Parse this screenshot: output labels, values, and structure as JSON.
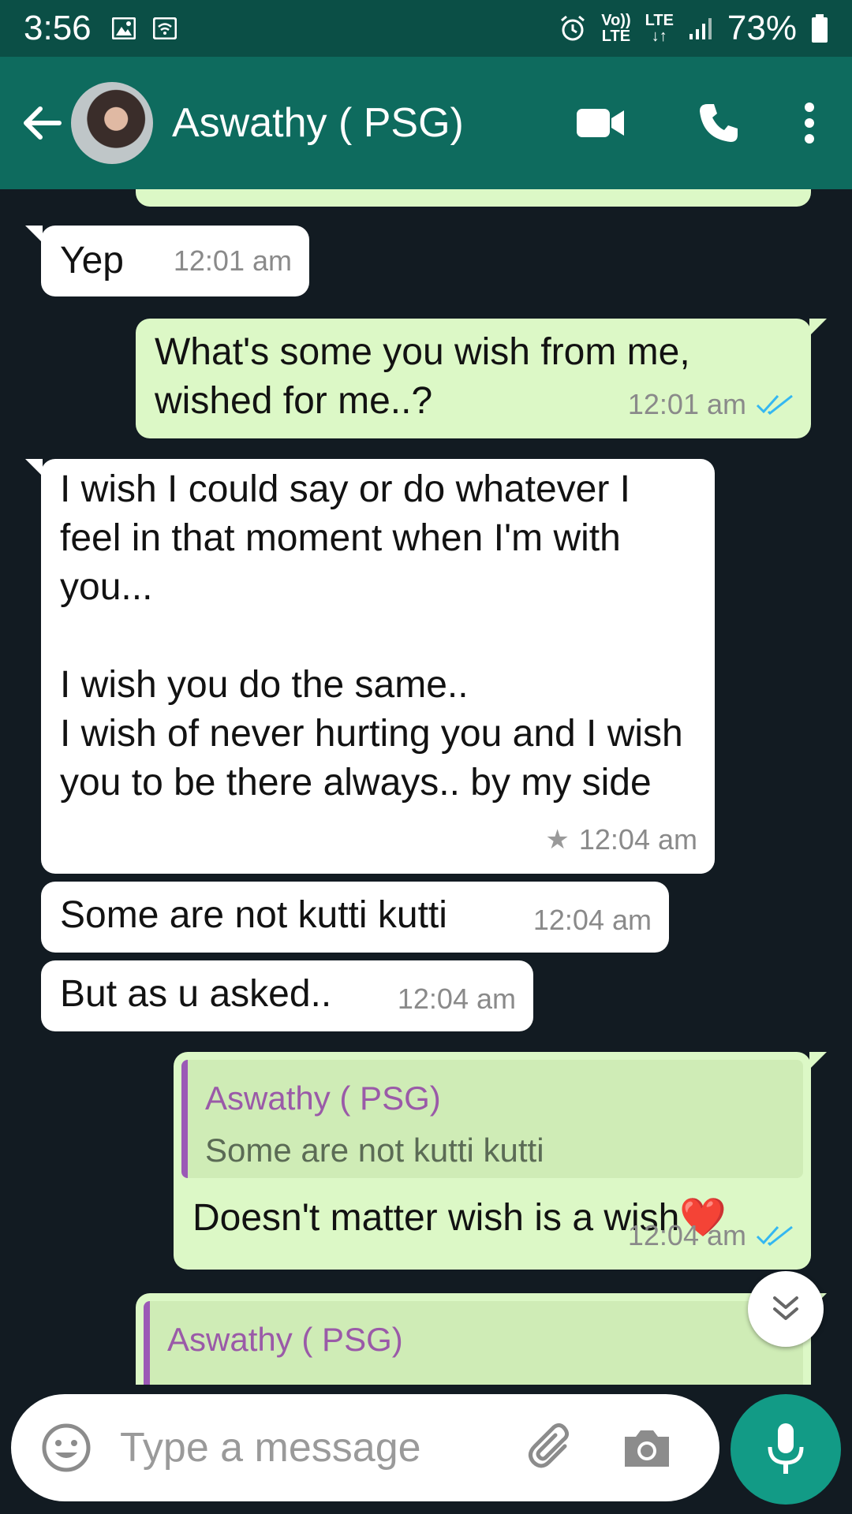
{
  "status_bar": {
    "time": "3:56",
    "network_top": "Vo))",
    "network_bottom": "LTE",
    "data_label": "LTE",
    "battery_percent": "73%"
  },
  "header": {
    "contact_name": "Aswathy ( PSG)"
  },
  "messages": [
    {
      "id": "m1",
      "direction": "in",
      "text": "Yep",
      "time": "12:01 am"
    },
    {
      "id": "m2",
      "direction": "out",
      "text": "What's some you wish from me, wished for me..?",
      "time": "12:01 am"
    },
    {
      "id": "m3",
      "direction": "in",
      "text": "I wish I could say or do whatever I feel in that moment when I'm with you...\n\nI wish you do the same..\nI wish of never hurting you and I wish you to be there always.. by my side",
      "time": "12:04 am",
      "starred": true
    },
    {
      "id": "m4",
      "direction": "in",
      "text": "Some are not kutti kutti",
      "time": "12:04 am"
    },
    {
      "id": "m5",
      "direction": "in",
      "text": "But as u asked..",
      "time": "12:04 am"
    },
    {
      "id": "m6",
      "direction": "out",
      "text": "Doesn't matter wish is a wish❤️",
      "time": "12:04 am",
      "quote": {
        "name": "Aswathy ( PSG)",
        "text": "Some are not kutti kutti"
      }
    },
    {
      "id": "m7",
      "direction": "out",
      "quote": {
        "name": "Aswathy ( PSG)"
      }
    }
  ],
  "composer": {
    "placeholder": "Type a message"
  },
  "colors": {
    "header": "#0e6b5e",
    "status_bar": "#0b4f46",
    "background": "#121b22",
    "incoming_bubble": "#ffffff",
    "outgoing_bubble": "#dcf8c6",
    "read_tick": "#34b7f1",
    "quote_name": "#9a5aa8",
    "mic_button": "#129b86"
  },
  "icons": [
    "back-arrow-icon",
    "video-call-icon",
    "voice-call-icon",
    "more-options-icon",
    "emoji-icon",
    "attach-icon",
    "camera-icon",
    "mic-icon",
    "star-icon",
    "double-check-icon",
    "scroll-down-icon"
  ]
}
